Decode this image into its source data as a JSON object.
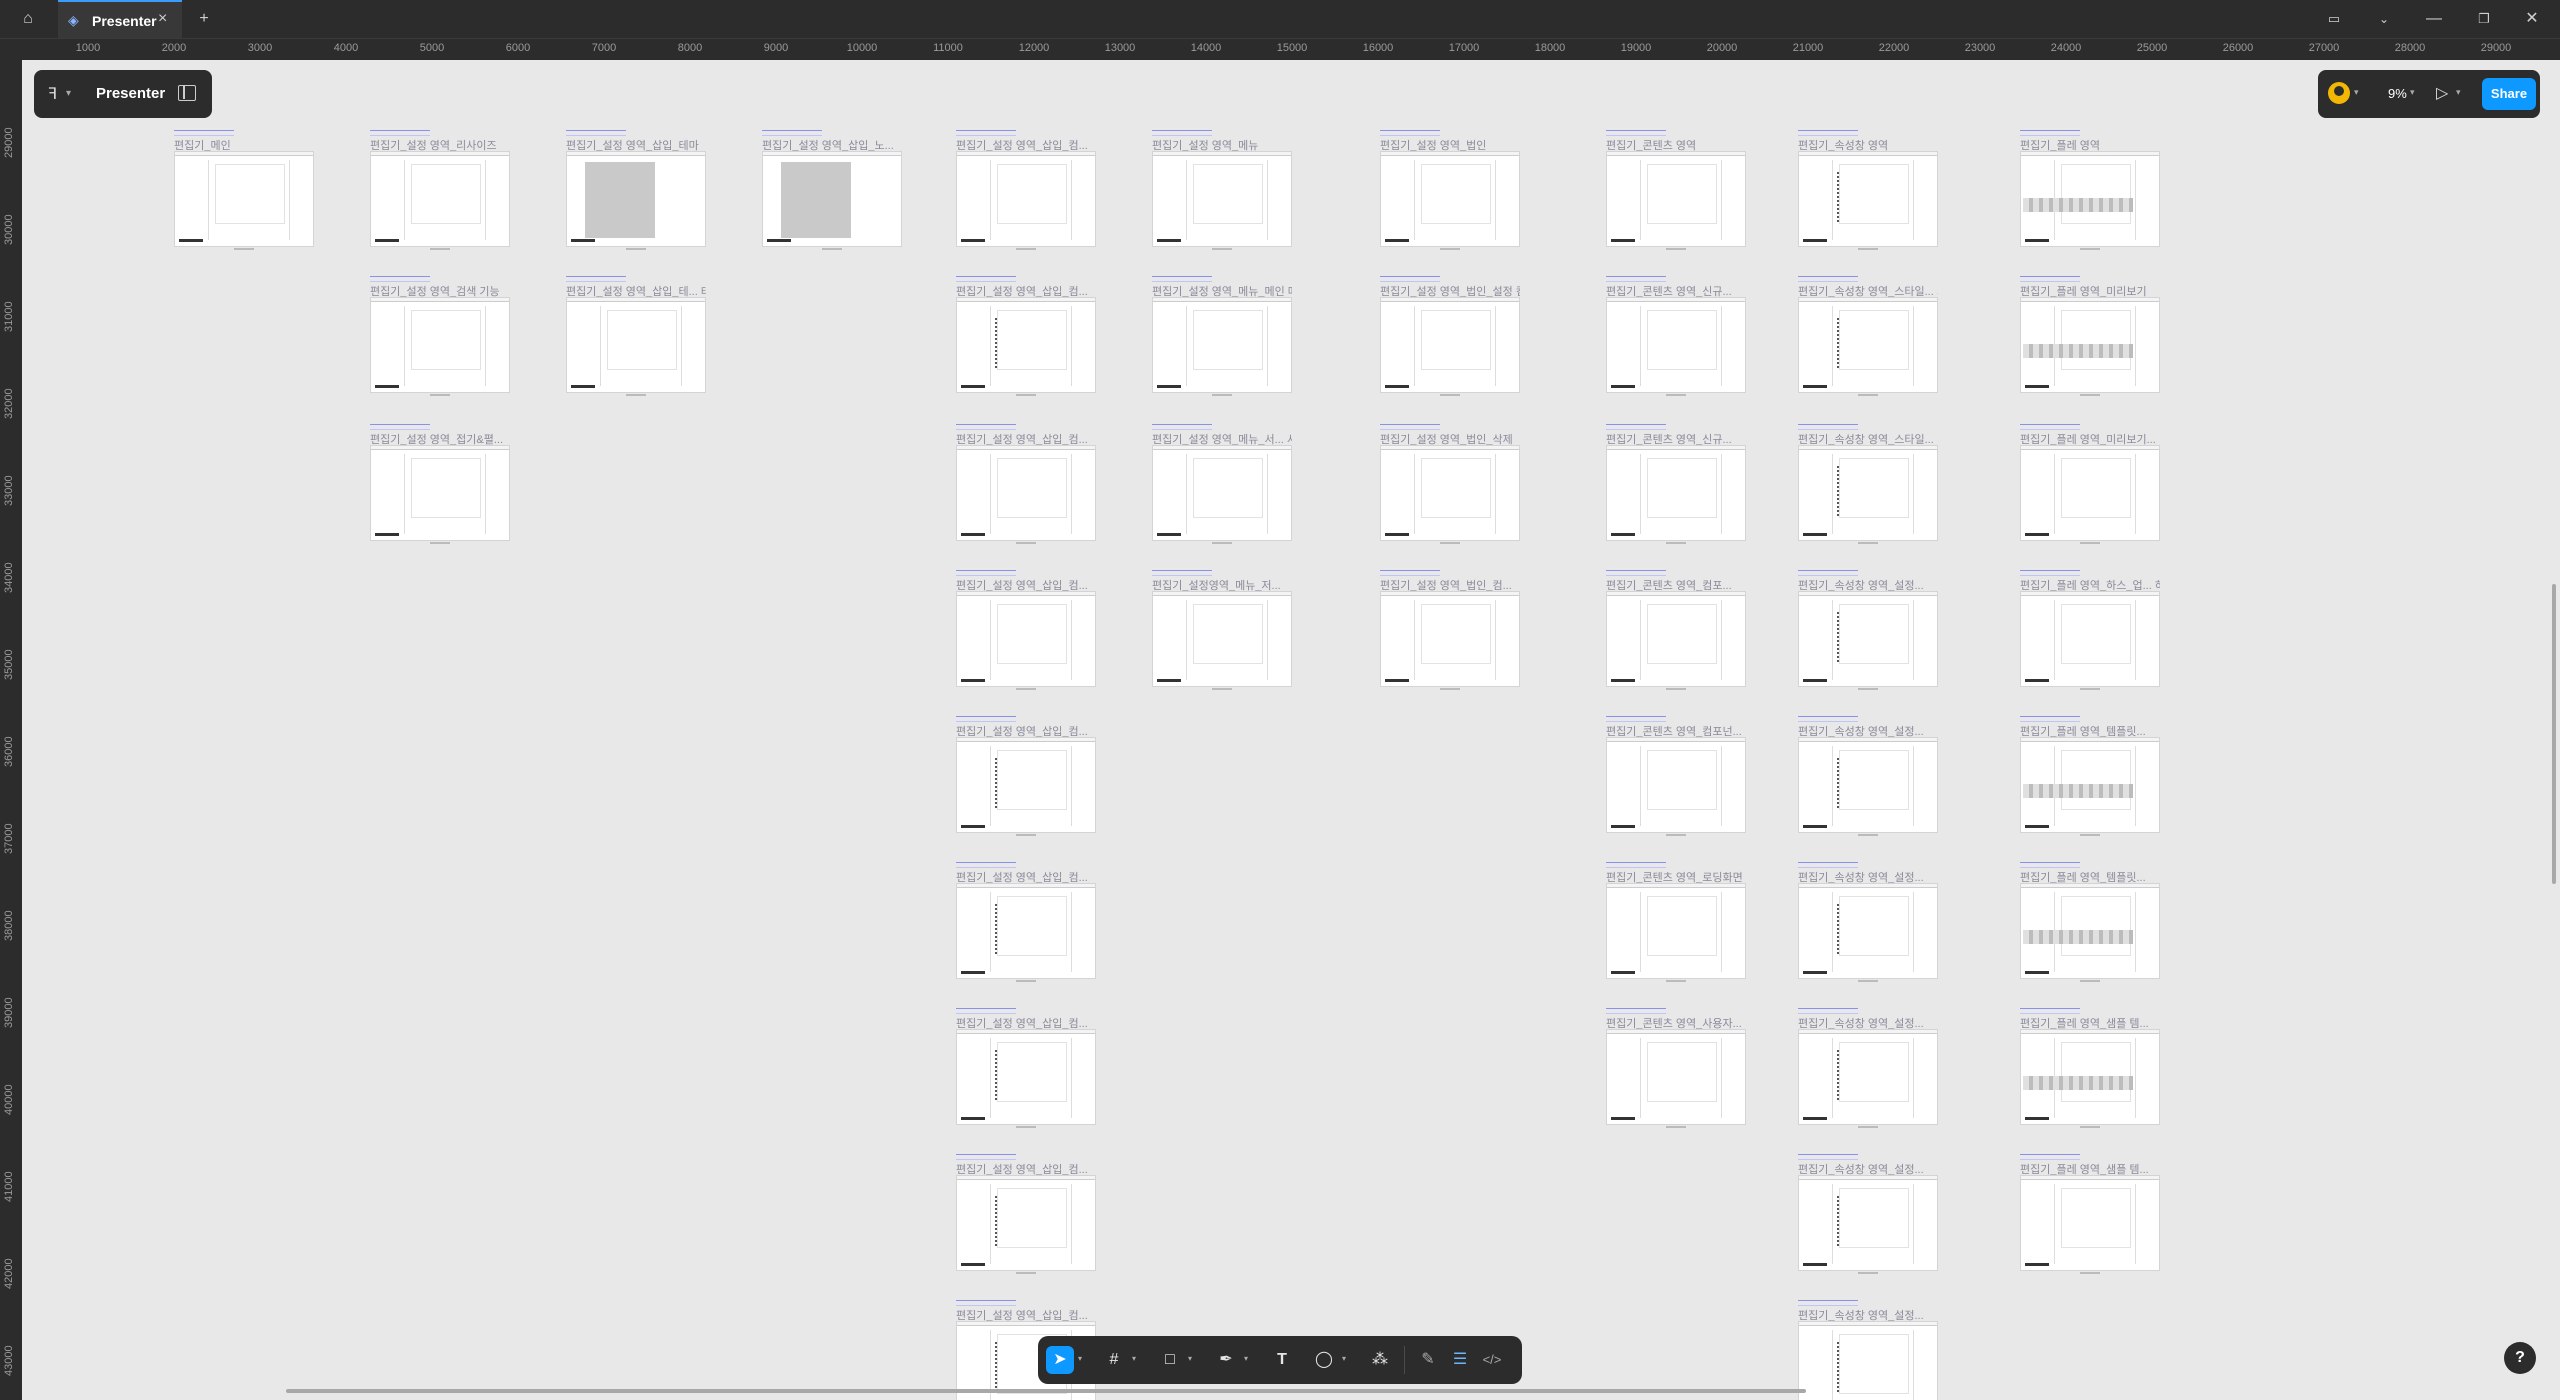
{
  "window": {
    "home_icon": "home-icon",
    "tab_name": "Presenter",
    "tab_icon": "figma-file-icon",
    "new_tab": "+",
    "controls": [
      "notification-icon",
      "chevron-down-icon",
      "minimize-icon",
      "restore-icon",
      "close-icon"
    ]
  },
  "ruler_x": [
    "1000",
    "2000",
    "3000",
    "4000",
    "5000",
    "6000",
    "7000",
    "8000",
    "9000",
    "10000",
    "11000",
    "12000",
    "13000",
    "14000",
    "15000",
    "16000",
    "17000",
    "18000",
    "19000",
    "20000",
    "21000",
    "22000",
    "23000",
    "24000",
    "25000",
    "26000",
    "27000",
    "28000",
    "29000"
  ],
  "ruler_y": [
    "29000",
    "30000",
    "31000",
    "32000",
    "33000",
    "34000",
    "35000",
    "36000",
    "37000",
    "38000",
    "39000",
    "40000",
    "41000",
    "42000",
    "43000"
  ],
  "left_panel": {
    "title": "Presenter"
  },
  "right_panel": {
    "zoom": "9%",
    "share": "Share"
  },
  "frames": [
    {
      "title": "편집기_메인",
      "kind": "plain"
    },
    {
      "title": "편집기_설정 영역_리사이즈",
      "kind": "plain"
    },
    {
      "title": "편집기_설정 영역_삽입_테마",
      "kind": "gray"
    },
    {
      "title": "편집기_설정 영역_삽입_노...",
      "kind": "gray"
    },
    {
      "title": "편집기_설정 영역_삽입_컴...",
      "kind": "plain"
    },
    {
      "title": "편집기_설정 영역_메뉴",
      "kind": "plain"
    },
    {
      "title": "편집기_설정 영역_법인",
      "kind": "plain"
    },
    {
      "title": "편집기_콘텐츠 영역",
      "kind": "plain"
    },
    {
      "title": "편집기_속성창 영역",
      "kind": "dots"
    },
    {
      "title": "편집기_플레 영역",
      "kind": "wave"
    },
    {
      "title": "편집기_설정 영역_검색 기능",
      "kind": "plain"
    },
    {
      "title": "편집기_설정 영역_삽입_테...  테...",
      "kind": "plain"
    },
    {
      "title": "편집기_설정 영역_삽입_컴...",
      "kind": "dots"
    },
    {
      "title": "편집기_설정 영역_메뉴_메인  메...",
      "kind": "plain"
    },
    {
      "title": "편집기_설정 영역_법인_설정  컴...",
      "kind": "plain"
    },
    {
      "title": "편집기_콘텐츠 영역_신규...",
      "kind": "plain"
    },
    {
      "title": "편집기_속성창 영역_스타일...  가...",
      "kind": "dots"
    },
    {
      "title": "편집기_플레 영역_미리보기",
      "kind": "wave"
    },
    {
      "title": "편집기_설정 영역_접기&펼...",
      "kind": "plain"
    },
    {
      "title": "편집기_설정 영역_삽입_컴...",
      "kind": "plain"
    },
    {
      "title": "편집기_설정 영역_메뉴_서...  서...",
      "kind": "plain"
    },
    {
      "title": "편집기_설정 영역_법인_삭제",
      "kind": "plain"
    },
    {
      "title": "편집기_콘텐츠 영역_신규...",
      "kind": "plain"
    },
    {
      "title": "편집기_속성창 영역_스타일...",
      "kind": "dots"
    },
    {
      "title": "편집기_플레 영역_미리보기...",
      "kind": "plain"
    },
    {
      "title": "편집기_설정 영역_삽입_컴...",
      "kind": "plain"
    },
    {
      "title": "편집기_설정영역_메뉴_저...",
      "kind": "plain"
    },
    {
      "title": "편집기_설정 영역_법인_컴...",
      "kind": "plain"
    },
    {
      "title": "편집기_콘텐츠 영역_컴포...",
      "kind": "plain"
    },
    {
      "title": "편집기_속성창 영역_설정...",
      "kind": "dots"
    },
    {
      "title": "편집기_플레 영역_하스_업...  하...",
      "kind": "plain"
    },
    {
      "title": "편집기_설정 영역_삽입_컴...",
      "kind": "dots"
    },
    {
      "title": "편집기_콘텐츠 영역_컴포넌...",
      "kind": "plain"
    },
    {
      "title": "편집기_속성창 영역_설정...",
      "kind": "dots"
    },
    {
      "title": "편집기_플레 영역_템플릿...",
      "kind": "wave"
    },
    {
      "title": "편집기_설정 영역_삽입_컴...",
      "kind": "dots"
    },
    {
      "title": "편집기_콘텐츠 영역_로딩화면",
      "kind": "plain"
    },
    {
      "title": "편집기_속성창 영역_설정...",
      "kind": "dots"
    },
    {
      "title": "편집기_플레 영역_템플릿...",
      "kind": "wave"
    },
    {
      "title": "편집기_설정 영역_삽입_컴...",
      "kind": "dots"
    },
    {
      "title": "편집기_콘텐츠 영역_사용자...",
      "kind": "plain"
    },
    {
      "title": "편집기_속성창 영역_설정...",
      "kind": "dots"
    },
    {
      "title": "편집기_플레 영역_샘플 템...",
      "kind": "wave"
    },
    {
      "title": "편집기_설정 영역_삽입_컴...",
      "kind": "dots"
    },
    {
      "title": "편집기_속성창 영역_설정...",
      "kind": "dots"
    },
    {
      "title": "편집기_플레 영역_샘플 템...",
      "kind": "plain"
    },
    {
      "title": "편집기_설정 영역_삽입_컴...",
      "kind": "dots"
    },
    {
      "title": "편집기_속성창 영역_설정...",
      "kind": "dots"
    }
  ],
  "toolbar": {
    "tools": [
      "move-tool-icon",
      "frame-tool-icon",
      "shape-tool-icon",
      "pen-tool-icon",
      "text-tool-icon",
      "comment-tool-icon",
      "actions-icon",
      "draw-mode-icon",
      "design-mode-icon",
      "dev-mode-icon"
    ]
  },
  "help": "?"
}
